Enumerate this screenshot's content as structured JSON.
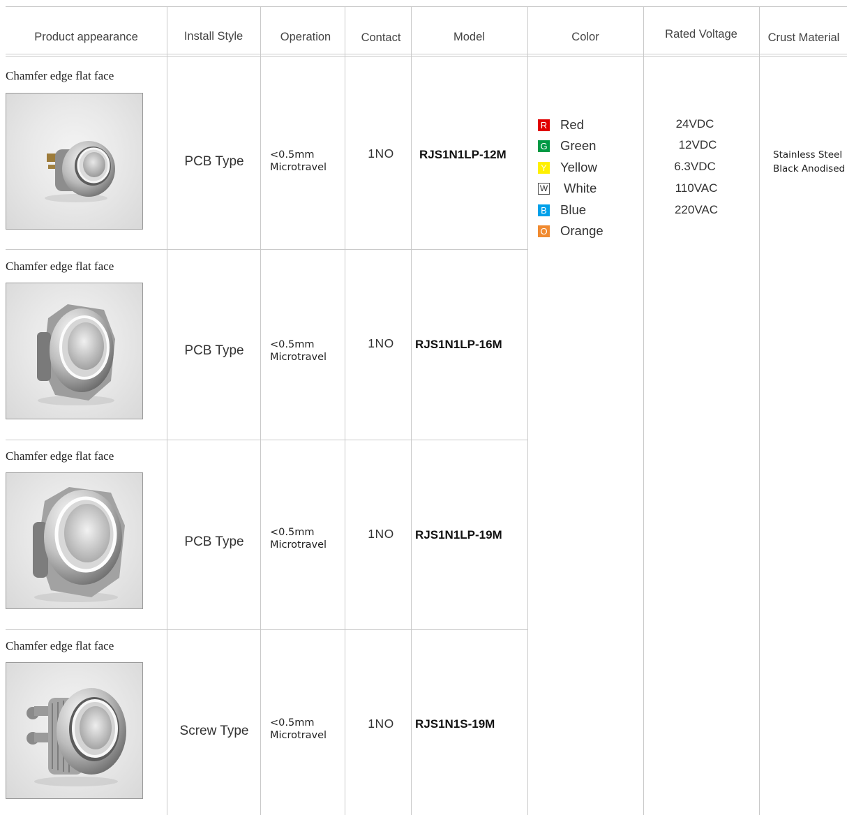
{
  "header": {
    "product_appearance": "Product appearance",
    "install_style": "Install Style",
    "operation": "Operation",
    "contact": "Contact",
    "model": "Model",
    "color": "Color",
    "rated_voltage": "Rated Voltage",
    "crust_material": "Crust Material"
  },
  "rows": [
    {
      "label": "Chamfer edge flat face",
      "image": "switch-12mm-image",
      "install": "PCB Type",
      "operation_line1": "<0.5mm",
      "operation_line2": "Microtravel",
      "contact": "1NO",
      "model": "RJS1N1LP-12M"
    },
    {
      "label": "Chamfer edge flat face",
      "image": "switch-16mm-image",
      "install": "PCB Type",
      "operation_line1": "<0.5mm",
      "operation_line2": "Microtravel",
      "contact": "1NO",
      "model": "RJS1N1LP-16M"
    },
    {
      "label": "Chamfer edge flat face",
      "image": "switch-19mm-image",
      "install": "PCB Type",
      "operation_line1": "<0.5mm",
      "operation_line2": "Microtravel",
      "contact": "1NO",
      "model": "RJS1N1LP-19M"
    },
    {
      "label": "Chamfer edge flat face",
      "image": "switch-19mm-screw-image",
      "install": "Screw Type",
      "operation_line1": "<0.5mm",
      "operation_line2": "Microtravel",
      "contact": "1NO",
      "model": "RJS1N1S-19M"
    }
  ],
  "colors": [
    {
      "code": "R",
      "name": "Red",
      "swatch": "#e00000"
    },
    {
      "code": "G",
      "name": "Green",
      "swatch": "#009944"
    },
    {
      "code": "Y",
      "name": "Yellow",
      "swatch": "#fff000"
    },
    {
      "code": "W",
      "name": "White",
      "swatch": "#ffffff"
    },
    {
      "code": "B",
      "name": "Blue",
      "swatch": "#00a0e9"
    },
    {
      "code": "O",
      "name": "Orange",
      "swatch": "#f08a30"
    }
  ],
  "voltages": [
    "24VDC",
    "12VDC",
    "6.3VDC",
    "110VAC",
    "220VAC"
  ],
  "crust": {
    "line1": "Stainless Steel",
    "line2": "Black Anodised"
  }
}
